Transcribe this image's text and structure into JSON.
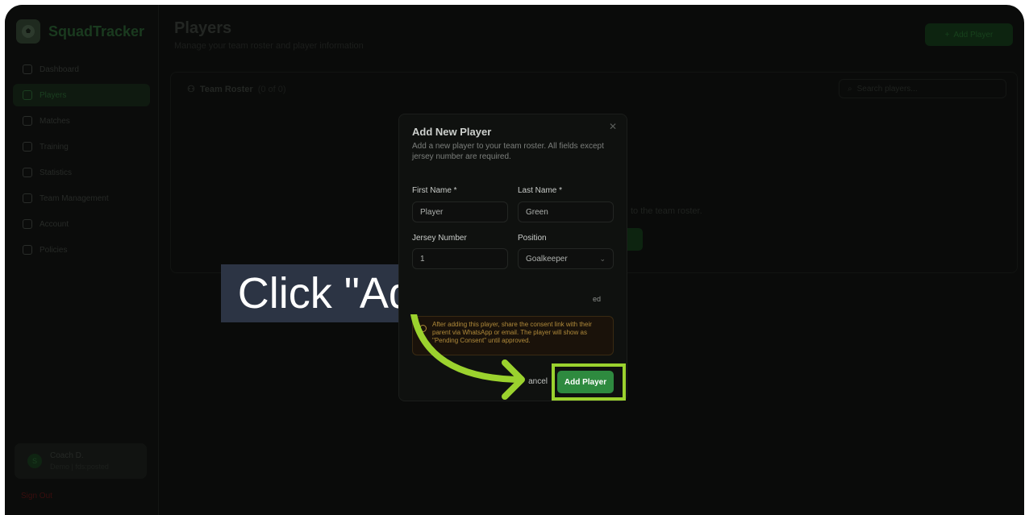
{
  "app": {
    "name": "SquadTracker"
  },
  "sidebar": {
    "items": [
      {
        "label": "Dashboard",
        "icon": "home-icon"
      },
      {
        "label": "Players",
        "icon": "users-icon",
        "active": true
      },
      {
        "label": "Matches",
        "icon": "trophy-icon"
      },
      {
        "label": "Training",
        "icon": "training-icon"
      },
      {
        "label": "Statistics",
        "icon": "chart-icon"
      },
      {
        "label": "Team Management",
        "icon": "team-icon"
      },
      {
        "label": "Account",
        "icon": "user-icon"
      },
      {
        "label": "Policies",
        "icon": "document-icon"
      }
    ],
    "user": {
      "initial": "S",
      "name": "Coach D.",
      "subtitle": "Demo | fds:posted"
    },
    "signout": "Sign Out"
  },
  "page": {
    "title": "Players",
    "subtitle": "Manage your team roster and player information",
    "add_button": "Add Player"
  },
  "roster": {
    "title": "Team Roster",
    "count": "(0 of 0)",
    "search_placeholder": "Search players...",
    "empty_text": "to the team roster."
  },
  "dialog": {
    "title": "Add New Player",
    "description": "Add a new player to your team roster. All fields except jersey number are required.",
    "first_name_label": "First Name *",
    "first_name_value": "Player",
    "last_name_label": "Last Name *",
    "last_name_value": "Green",
    "jersey_label": "Jersey Number",
    "jersey_value": "1",
    "position_label": "Position",
    "position_value": "Goalkeeper",
    "cut_text": "ed",
    "warning": "After adding this player, share the consent link with their parent via WhatsApp or email. The player will show as \"Pending Consent\" until approved.",
    "cancel_label": "ancel",
    "submit_label": "Add Player"
  },
  "callout": {
    "text": "Click \"Add Player\""
  },
  "colors": {
    "accent": "#2e8a3f",
    "highlight": "#9bd22e",
    "callout_bg": "#2c3444"
  }
}
